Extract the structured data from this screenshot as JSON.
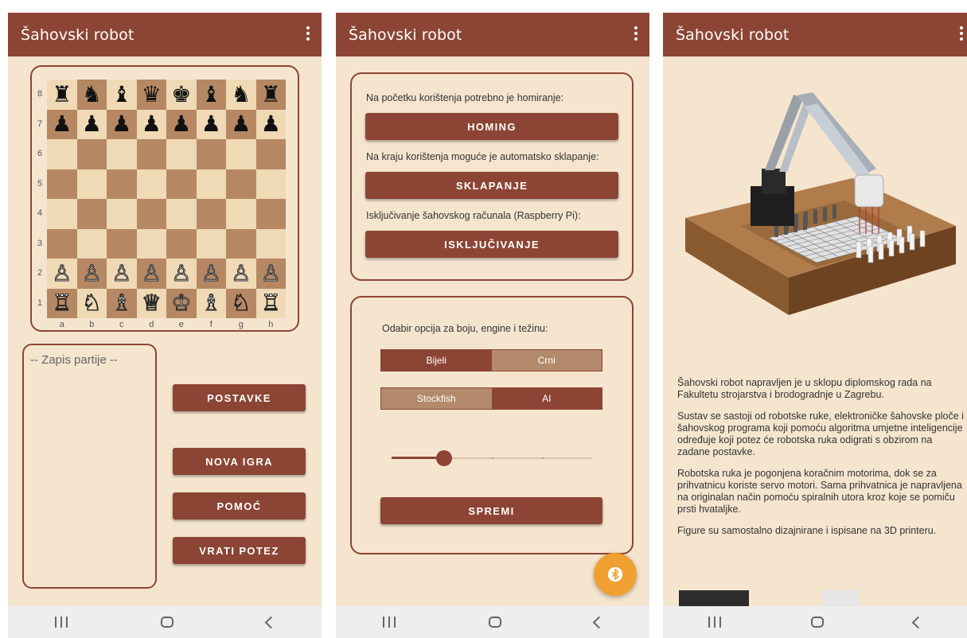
{
  "app": {
    "title": "Šahovski robot"
  },
  "screen1": {
    "board": {
      "rows": [
        [
          "♜",
          "♞",
          "♝",
          "♛",
          "♚",
          "♝",
          "♞",
          "♜"
        ],
        [
          "♟",
          "♟",
          "♟",
          "♟",
          "♟",
          "♟",
          "♟",
          "♟"
        ],
        [
          "",
          "",
          "",
          "",
          "",
          "",
          "",
          ""
        ],
        [
          "",
          "",
          "",
          "",
          "",
          "",
          "",
          ""
        ],
        [
          "",
          "",
          "",
          "",
          "",
          "",
          "",
          ""
        ],
        [
          "",
          "",
          "",
          "",
          "",
          "",
          "",
          ""
        ],
        [
          "♙",
          "♙",
          "♙",
          "♙",
          "♙",
          "♙",
          "♙",
          "♙"
        ],
        [
          "♖",
          "♘",
          "♗",
          "♕",
          "♔",
          "♗",
          "♘",
          "♖"
        ]
      ],
      "ranks": [
        "8",
        "7",
        "6",
        "5",
        "4",
        "3",
        "2",
        "1"
      ],
      "files": [
        "a",
        "b",
        "c",
        "d",
        "e",
        "f",
        "g",
        "h"
      ]
    },
    "record_title": "-- Zapis partije --",
    "buttons": {
      "settings": "POSTAVKE",
      "new_game": "NOVA IGRA",
      "help": "POMOĆ",
      "undo": "VRATI POTEZ"
    }
  },
  "screen2": {
    "homing_label": "Na početku korištenja potrebno je homiranje:",
    "homing_button": "HOMING",
    "fold_label": "Na kraju korištenja moguće je automatsko sklapanje:",
    "fold_button": "SKLAPANJE",
    "shutdown_label": "Isključivanje šahovskog računala (Raspberry Pi):",
    "shutdown_button": "ISKLJUČIVANJE",
    "options_label": "Odabir opcija za boju, engine i težinu:",
    "color": {
      "white": "Bijeli",
      "black": "Crni",
      "selected": "Bijeli"
    },
    "engine": {
      "stockfish": "Stockfish",
      "ai": "AI",
      "selected": "AI"
    },
    "difficulty": {
      "value": 0.26,
      "ticks": 4
    },
    "save_button": "SPREMI"
  },
  "screen3": {
    "paragraphs": [
      "Šahovski robot napravljen je u sklopu diplomskog rada na Fakultetu strojarstva i brodogradnje u Zagrebu.",
      "Sustav se sastoji od robotske ruke, elektroničke šahovske ploče i šahovskog programa koji pomoću algoritma umjetne inteligencije određuje koji potez će robotska ruka odigrati s obzirom na zadane postavke.",
      "Robotska ruka je pogonjena koračnim motorima, dok se za prihvatnicu koriste servo motori. Sama prihvatnica je napravljena na originalan način pomoću spiralnih utora kroz koje se pomiču prsti hvataljke.",
      "Figure su samostalno dizajnirane i ispisane na 3D printeru."
    ]
  },
  "colors": {
    "primary": "#8c4534",
    "background": "#f5e5cf",
    "fab": "#f0a030",
    "segment_off": "#b38a6b"
  },
  "icons": [
    "more-vert-icon",
    "bluetooth-icon",
    "nav-recent-icon",
    "nav-home-icon",
    "nav-back-icon"
  ]
}
